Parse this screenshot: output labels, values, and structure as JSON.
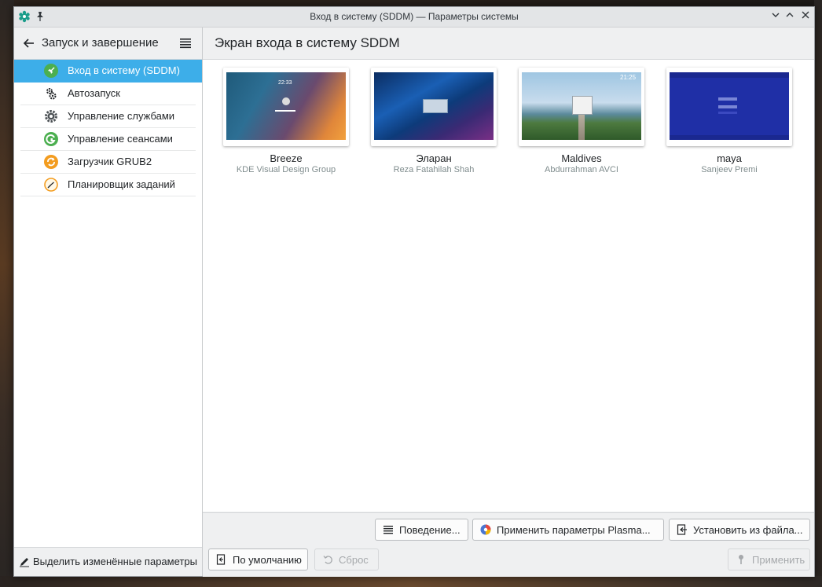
{
  "window": {
    "title": "Вход в систему (SDDM) — Параметры системы",
    "buttons": [
      "minimize",
      "maximize",
      "close"
    ]
  },
  "sidebar": {
    "header_title": "Запуск и завершение",
    "items": [
      {
        "label": "Вход в систему (SDDM)",
        "icon": "rocket-icon",
        "active": true
      },
      {
        "label": "Автозапуск",
        "icon": "gears-icon",
        "active": false
      },
      {
        "label": "Управление службами",
        "icon": "gear-icon",
        "active": false
      },
      {
        "label": "Управление сеансами",
        "icon": "session-icon",
        "active": false
      },
      {
        "label": "Загрузчик GRUB2",
        "icon": "grub-icon",
        "active": false
      },
      {
        "label": "Планировщик заданий",
        "icon": "clock-icon",
        "active": false
      }
    ],
    "footer_label": "Выделить изменённые параметры"
  },
  "main": {
    "page_title": "Экран входа в систему SDDM",
    "themes": [
      {
        "name": "Breeze",
        "author": "KDE Visual Design Group"
      },
      {
        "name": "Эларан",
        "author": "Reza Fatahilah Shah"
      },
      {
        "name": "Maldives",
        "author": "Abdurrahman AVCI"
      },
      {
        "name": "maya",
        "author": "Sanjeev Premi"
      }
    ],
    "thumb_text": {
      "breeze_time": "22:33",
      "maldives_time": "21:25"
    },
    "buttons": {
      "behavior": "Поведение...",
      "apply_plasma": "Применить параметры Plasma...",
      "install_from_file": "Установить из файла...",
      "defaults": "По умолчанию",
      "reset": "Сброс",
      "apply": "Применить"
    }
  },
  "colors": {
    "accent": "#3daee9",
    "window_bg": "#eff0f1",
    "text": "#232629"
  }
}
